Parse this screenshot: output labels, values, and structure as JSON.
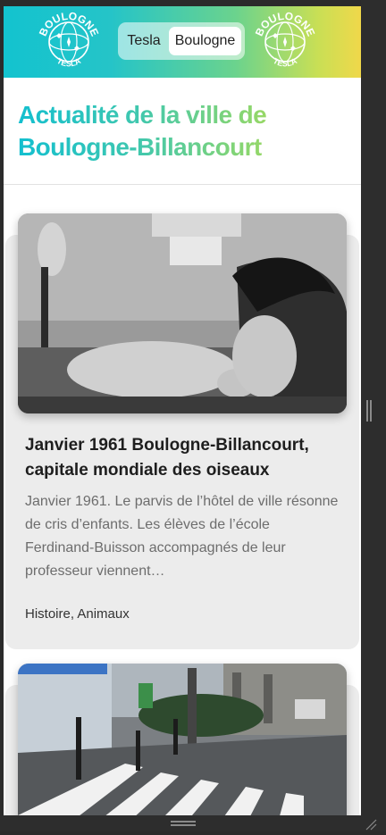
{
  "header": {
    "logo_text_top": "BOULOGNE",
    "logo_text_bottom": "TESLA",
    "switch": {
      "option_tesla": "Tesla",
      "option_boulogne": "Boulogne",
      "selected": "Boulogne"
    },
    "gradient_colors": [
      "#13c3cf",
      "#6bd38d",
      "#f0d84a"
    ]
  },
  "page": {
    "title": "Actualité de la ville de Boulogne-Billancourt"
  },
  "articles": [
    {
      "title": "Janvier 1961 Boulogne-Billancourt, capitale mondiale des oiseaux",
      "excerpt": "Janvier 1961. Le parvis de l’hôtel de ville résonne de cris d’enfants. Les élèves de l’école Ferdinand-Buisson accompagnés de leur professeur viennent…",
      "tags": "Histoire, Animaux",
      "image": "black-and-white-photo-child-with-parrots"
    },
    {
      "image": "street-crosswalk-photo"
    }
  ],
  "colors": {
    "card_background": "#ececec",
    "accent_start": "#13bfcf",
    "accent_end": "#d6de3e"
  }
}
